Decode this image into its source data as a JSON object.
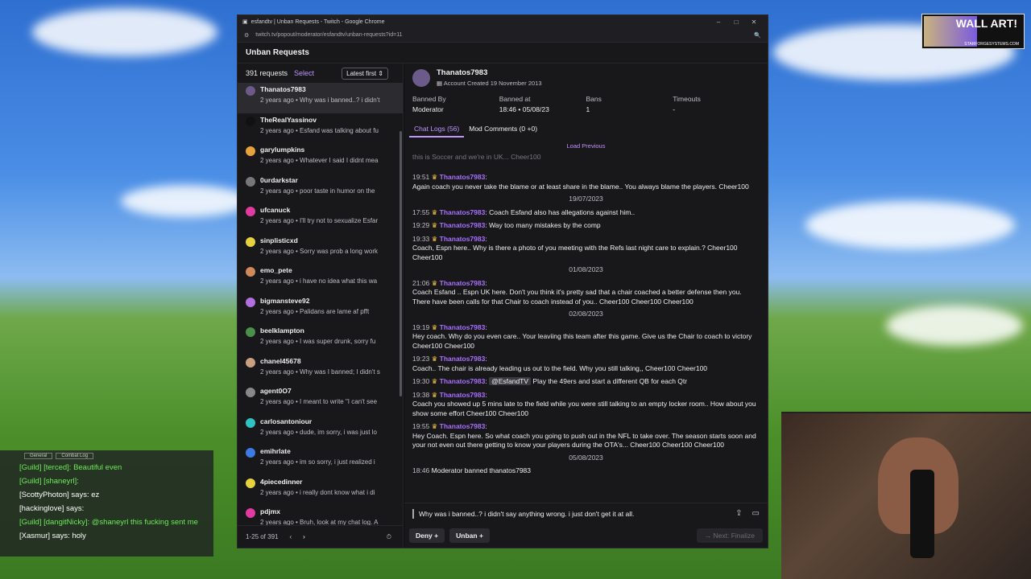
{
  "window": {
    "title": "esfandtv | Unban Requests - Twitch - Google Chrome",
    "url": "twitch.tv/popout/moderator/esfandtv/unban-requests?id=11",
    "app_title": "Unban Requests"
  },
  "list": {
    "count": "391 requests",
    "select": "Select",
    "sort": "Latest first",
    "pagination": "1-25 of 391",
    "items": [
      {
        "name": "Thanatos7983",
        "sub": "2 years ago • Why was i banned..? i didn't",
        "color": "#6b5a8a"
      },
      {
        "name": "TheRealYassinov",
        "sub": "2 years ago • Esfand was talking about fu",
        "color": "#111111"
      },
      {
        "name": "garylumpkins",
        "sub": "2 years ago • Whatever I said I didnt mea",
        "color": "#e6a23c"
      },
      {
        "name": "0urdarkstar",
        "sub": "2 years ago • poor taste in humor on the",
        "color": "#777777"
      },
      {
        "name": "ufcanuck",
        "sub": "2 years ago • I'll try not to sexualize Esfar",
        "color": "#e03ca0"
      },
      {
        "name": "sinplisticxd",
        "sub": "2 years ago • Sorry was prob a long work",
        "color": "#e6d23c"
      },
      {
        "name": "emo_pete",
        "sub": "2 years ago • i have no idea what this wa",
        "color": "#d08a5a"
      },
      {
        "name": "bigmansteve92",
        "sub": "2 years ago • Palidans are lame af pfft",
        "color": "#b070e0"
      },
      {
        "name": "beelklampton",
        "sub": "2 years ago • I was super drunk, sorry fu",
        "color": "#4a8f4a"
      },
      {
        "name": "chanel45678",
        "sub": "2 years ago • Why was I banned; I didn't s",
        "color": "#c8a080"
      },
      {
        "name": "agent0O7",
        "sub": "2 years ago • I meant to write \"I can't see",
        "color": "#888888"
      },
      {
        "name": "carlosantoniour",
        "sub": "2 years ago • dude, im sorry, i was just lo",
        "color": "#2ec4c4"
      },
      {
        "name": "emihrlate",
        "sub": "2 years ago • im so sorry, i just realized i",
        "color": "#3c7be6"
      },
      {
        "name": "4piecedinner",
        "sub": "2 years ago • i really dont know what i di",
        "color": "#e6d23c"
      },
      {
        "name": "pdjmx",
        "sub": "2 years ago • Bruh, look at my chat log. A",
        "color": "#e03ca0"
      }
    ]
  },
  "detail": {
    "username": "Thanatos7983",
    "created": "Account Created 19 November 2013",
    "stats": [
      {
        "label": "Banned By",
        "value": "Moderator"
      },
      {
        "label": "Banned at",
        "value": "18:46 • 05/08/23"
      },
      {
        "label": "Bans",
        "value": "1"
      },
      {
        "label": "Timeouts",
        "value": "-"
      }
    ],
    "tabs": [
      "Chat Logs (56)",
      "Mod Comments (0 +0)"
    ],
    "load_previous": "Load Previous",
    "faded": "this is Soccer and we're in UK... Cheer100",
    "entries": [
      {
        "type": "msg",
        "time": "19:51",
        "user": "Thanatos7983",
        "text": "Again coach you never take the blame or at least share in the blame.. You always blame the players. Cheer100"
      },
      {
        "type": "date",
        "text": "19/07/2023"
      },
      {
        "type": "msg",
        "time": "17:55",
        "user": "Thanatos7983",
        "text": "Coach Esfand also has allegations against him.."
      },
      {
        "type": "msg",
        "time": "19:29",
        "user": "Thanatos7983",
        "text": "Way too many mistakes by the comp"
      },
      {
        "type": "msg",
        "time": "19:33",
        "user": "Thanatos7983",
        "text": "Coach, Espn here.. Why is there a photo of you meeting with the Refs last night care to explain.? Cheer100 Cheer100"
      },
      {
        "type": "date",
        "text": "01/08/2023"
      },
      {
        "type": "msg",
        "time": "21:06",
        "user": "Thanatos7983",
        "text": "Coach Esfand .. Espn UK here. Don't you think it's pretty sad that a chair coached a better defense then you. There have been calls for that Chair to coach instead of you.. Cheer100 Cheer100 Cheer100"
      },
      {
        "type": "date",
        "text": "02/08/2023"
      },
      {
        "type": "msg",
        "time": "19:19",
        "user": "Thanatos7983",
        "text": "Hey coach. Why do you even care.. Your leaviing this team after this game. Give us the Chair to coach to victory Cheer100 Cheer100"
      },
      {
        "type": "msg",
        "time": "19:23",
        "user": "Thanatos7983",
        "text": "Coach.. The chair is already leading us out to the field. Why you still talking,, Cheer100 Cheer100"
      },
      {
        "type": "msg",
        "time": "19:30",
        "user": "Thanatos7983",
        "mention": "@EsfandTV",
        "text": "Play the 49ers and start a different QB for each Qtr"
      },
      {
        "type": "msg",
        "time": "19:38",
        "user": "Thanatos7983",
        "text": "Coach you showed up 5 mins late to the field while you were still talking to an empty locker room.. How about you show some effort Cheer100 Cheer100"
      },
      {
        "type": "msg",
        "time": "19:55",
        "user": "Thanatos7983",
        "text": "Hey Coach. Espn here. So what coach you going to push out in the NFL to take over. The season starts soon and your not even out there getting to know your players during the OTA's... Cheer100 Cheer100 Cheer100"
      },
      {
        "type": "date",
        "text": "05/08/2023"
      },
      {
        "type": "mod",
        "time": "18:46",
        "text": "Moderator banned thanatos7983"
      }
    ],
    "reason": "Why was i banned..? i didn't say anything wrong. i just don't get it at all.",
    "deny": "Deny",
    "unban": "Unban",
    "next": "Next: Finalize"
  },
  "overlay_chat": {
    "tabs": [
      "General",
      "Combat Log"
    ],
    "lines": [
      {
        "prefix": "[Guild] [terced]:",
        "text": "Beautiful even",
        "green": true
      },
      {
        "prefix": "[Guild] [shaneyrl]:",
        "text": "",
        "green": true
      },
      {
        "prefix": "[ScottyPhoton] says:",
        "text": "ez",
        "green": false
      },
      {
        "prefix": "[hackinglove] says:",
        "text": "",
        "green": false
      },
      {
        "prefix": "[Guild] [dangitNicky]:",
        "text": "@shaneyrl this fucking sent me",
        "green": true
      },
      {
        "prefix": "[Xasmur] says:",
        "text": "holy",
        "green": false
      }
    ]
  },
  "logo": {
    "text": "WALL ART!",
    "sub": "STARFORGESYSTEMS.COM"
  }
}
